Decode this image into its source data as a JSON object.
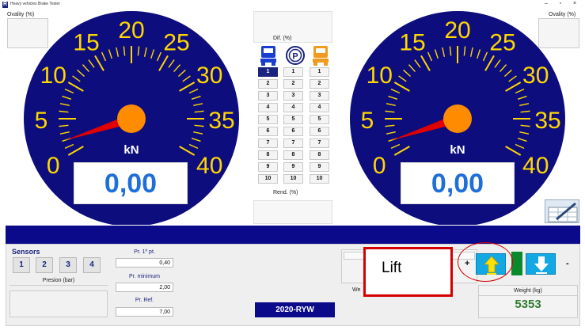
{
  "window": {
    "title": "Heavy vehicles Brake Tester",
    "minimize": "–",
    "maximize": "▫",
    "close": "×"
  },
  "left_gauge": {
    "ovality_label": "Ovality (%)",
    "unit": "kN",
    "value": "0,00",
    "ticks": [
      "0",
      "5",
      "10",
      "15",
      "20",
      "25",
      "30",
      "35",
      "40"
    ],
    "needle_value": 0
  },
  "right_gauge": {
    "ovality_label": "Ovality (%)",
    "unit": "kN",
    "value": "0,00",
    "ticks": [
      "0",
      "5",
      "10",
      "15",
      "20",
      "25",
      "30",
      "35",
      "40"
    ],
    "needle_value": 0
  },
  "center": {
    "dif_label": "Dif. (%)",
    "rend_label": "Rend. (%)",
    "axle_numbers": [
      "1",
      "2",
      "3",
      "4",
      "5",
      "6",
      "7",
      "8",
      "9",
      "10"
    ],
    "selected_axle": "1",
    "parking_symbol": "P"
  },
  "sensors": {
    "title": "Sensors",
    "buttons": [
      "1",
      "2",
      "3",
      "4"
    ],
    "presion_label": "Presion (bar)"
  },
  "pressure": {
    "pr1_label": "Pr. 1º pt.",
    "pr1_value": "0,40",
    "prmin_label": "Pr. minimum",
    "prmin_value": "2,00",
    "prref_label": "Pr. Ref.",
    "prref_value": "7,00"
  },
  "plate": "2020-RYW",
  "weight": {
    "we_partial": "We",
    "label": "Weight (kg)",
    "value": "5353"
  },
  "lift": {
    "label": "Lift",
    "plus": "+",
    "minus": "-"
  },
  "colors": {
    "gauge_bg": "#0d0d7d",
    "gauge_text": "#ffd700",
    "hub": "#ff8c00",
    "needle": "#e00000",
    "value_text": "#1e6fd9",
    "lift_btn": "#13a7e4",
    "weight_value": "#2e7d32"
  }
}
